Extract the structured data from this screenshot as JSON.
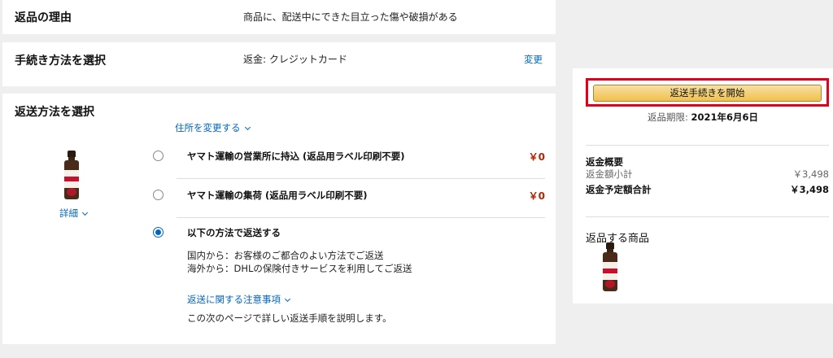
{
  "reason": {
    "title": "返品の理由",
    "value": "商品に、配送中にできた目立った傷や破損がある"
  },
  "method": {
    "title": "手続き方法を選択",
    "value": "返金: クレジットカード",
    "change_label": "変更"
  },
  "shipping": {
    "title": "返送方法を選択",
    "address_link": "住所を変更する",
    "details_link": "詳細",
    "options": [
      {
        "label": "ヤマト運輸の営業所に持込 (返品用ラベル印刷不要)",
        "price": "￥0",
        "selected": false
      },
      {
        "label": "ヤマト運輸の集荷 (返品用ラベル印刷不要)",
        "price": "￥0",
        "selected": false
      },
      {
        "label": "以下の方法で返送する",
        "price": "",
        "selected": true
      }
    ],
    "note_domestic": "国内から：お客様のご都合のよい方法でご返送",
    "note_international": "海外から：DHLの保険付きサービスを利用してご返送",
    "notice_link": "返送に関する注意事項",
    "next_page_text": "この次のページで詳しい返送手順を説明します。"
  },
  "sidebar": {
    "start_button": "返送手続きを開始",
    "deadline_label": "返品期限:",
    "deadline_date": "2021年6月6日",
    "refund_summary_title": "返金概要",
    "subtotal_label": "返金額小計",
    "subtotal_value": "￥3,498",
    "total_label": "返金予定額合計",
    "total_value": "￥3,498",
    "items_title": "返品する商品"
  },
  "colors": {
    "link": "#0066c0",
    "price": "#b12704",
    "highlight_frame": "#e4001b",
    "button": "#f0c14b"
  }
}
